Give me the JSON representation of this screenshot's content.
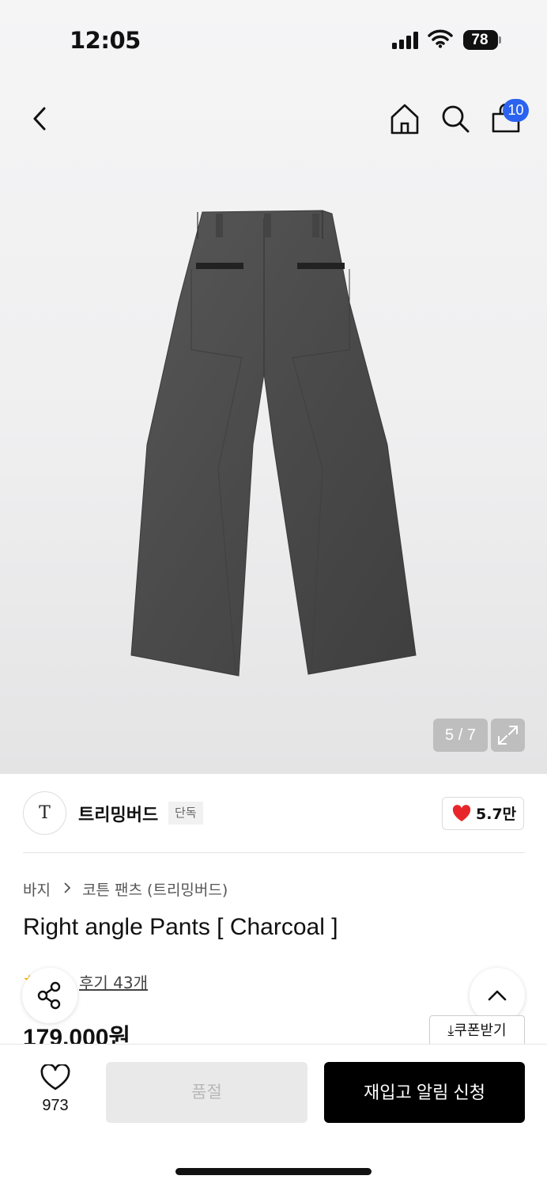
{
  "status_bar": {
    "time": "12:05",
    "battery": "78"
  },
  "nav": {
    "cart_count": "10"
  },
  "gallery": {
    "counter": "5 / 7"
  },
  "brand": {
    "logo_text": "T",
    "name": "트리밍버드",
    "tag": "단독",
    "likes": "5.7만"
  },
  "breadcrumb": {
    "category": "바지",
    "subcategory": "코튼 팬츠 (트리밍버드)"
  },
  "product": {
    "title": "Right angle Pants [ Charcoal ]",
    "review_text": "후기 43개",
    "price": "179,000원"
  },
  "coupon": {
    "label": "쿠폰받기"
  },
  "bottom_bar": {
    "wish_count": "973",
    "soldout_label": "품절",
    "restock_label": "재입고 알림 신청"
  },
  "colors": {
    "accent_badge": "#2b63f0",
    "heart": "#e8262a",
    "primary_button": "#000000"
  }
}
